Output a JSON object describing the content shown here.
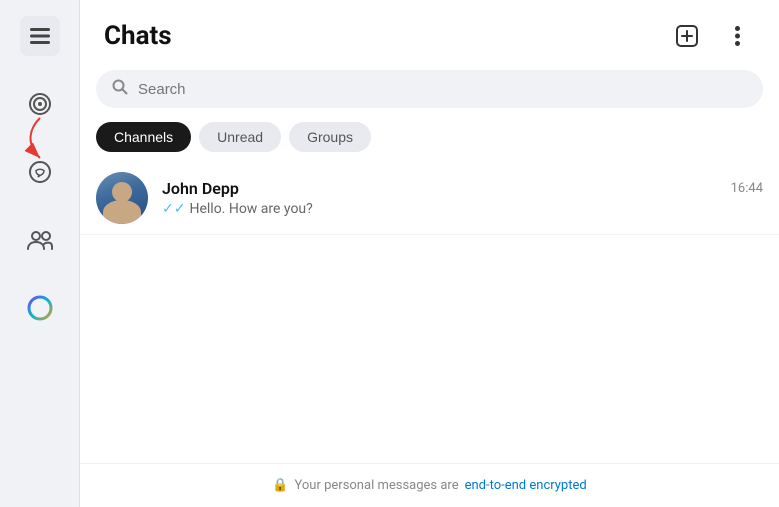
{
  "sidebar": {
    "icons": [
      {
        "name": "menu-icon",
        "symbol": "☰",
        "active": true
      },
      {
        "name": "target-icon",
        "symbol": "◎",
        "active": false
      },
      {
        "name": "chat-icon",
        "symbol": "💬",
        "active": false
      },
      {
        "name": "group-icon",
        "symbol": "👥",
        "active": false
      },
      {
        "name": "circle-icon",
        "symbol": "○",
        "active": false
      }
    ]
  },
  "header": {
    "title": "Chats",
    "new_chat_label": "new-chat",
    "more_options_label": "more-options"
  },
  "search": {
    "placeholder": "Search"
  },
  "filter_tabs": [
    {
      "label": "Channels",
      "active": true
    },
    {
      "label": "Unread",
      "active": false
    },
    {
      "label": "Groups",
      "active": false
    }
  ],
  "chats": [
    {
      "name": "John Depp",
      "preview": "Hello. How are you?",
      "time": "16:44",
      "double_read": true
    }
  ],
  "encryption_notice": {
    "text": "Your personal messages are ",
    "link_text": "end-to-end encrypted"
  }
}
